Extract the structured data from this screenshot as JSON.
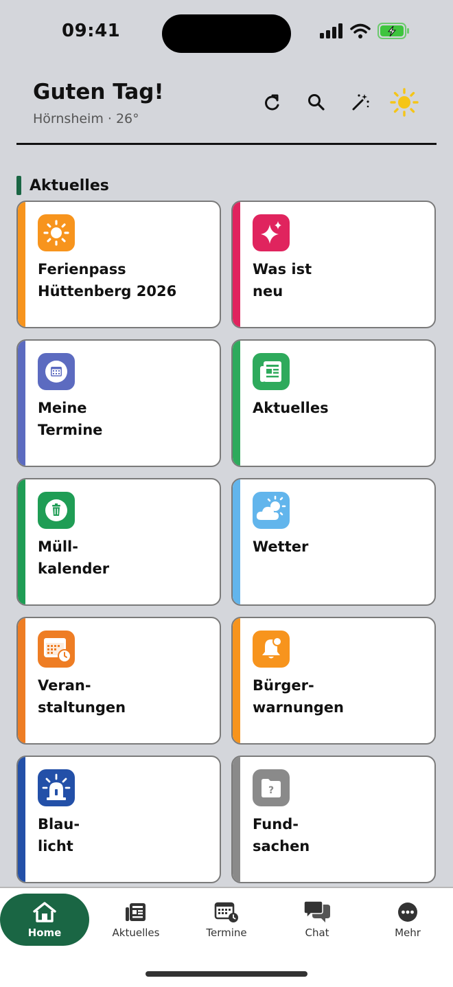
{
  "status_bar": {
    "time": "09:41"
  },
  "header": {
    "greeting": "Guten Tag!",
    "location": "Hörnsheim · 26°"
  },
  "section": {
    "title": "Aktuelles"
  },
  "tiles": [
    {
      "label": "Ferienpass\nHüttenberg 2026",
      "icon": "sun-icon",
      "color": "#f7941d"
    },
    {
      "label": "Was ist\nneu",
      "icon": "sparkles-icon",
      "color": "#e0245e"
    },
    {
      "label": "Meine\nTermine",
      "icon": "calendar-icon",
      "color": "#5c6bc0"
    },
    {
      "label": "Aktuelles",
      "icon": "newspaper-icon",
      "color": "#2eaa5c"
    },
    {
      "label": "Müll-\nkalender",
      "icon": "trash-icon",
      "color": "#1f9d55"
    },
    {
      "label": "Wetter",
      "icon": "cloud-sun-icon",
      "color": "#62b5ec"
    },
    {
      "label": "Veran-\nstaltungen",
      "icon": "event-calendar-icon",
      "color": "#ee7d24"
    },
    {
      "label": "Bürger-\nwarnungen",
      "icon": "bell-icon",
      "color": "#f7941d"
    },
    {
      "label": "Blau-\nlicht",
      "icon": "siren-icon",
      "color": "#2350a8"
    },
    {
      "label": "Fund-\nsachen",
      "icon": "lost-found-icon",
      "color": "#8a8a8a"
    }
  ],
  "nav": {
    "items": [
      {
        "label": "Home",
        "icon": "home-icon"
      },
      {
        "label": "Aktuelles",
        "icon": "news-icon"
      },
      {
        "label": "Termine",
        "icon": "calendar-clock-icon"
      },
      {
        "label": "Chat",
        "icon": "chat-icon"
      },
      {
        "label": "Mehr",
        "icon": "more-icon"
      }
    ]
  },
  "colors": {
    "brand": "#1a6644",
    "background": "#d4d6db",
    "battery": "#3ec43e",
    "sun": "#f5c518"
  }
}
